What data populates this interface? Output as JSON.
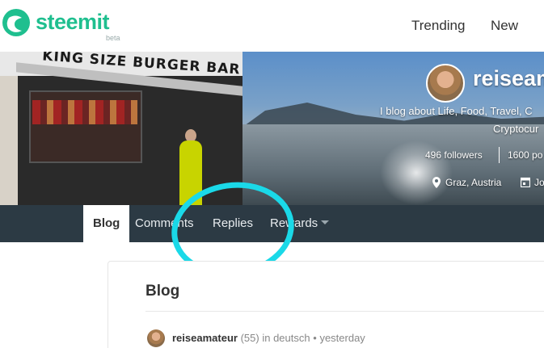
{
  "header": {
    "brand": "steemit",
    "beta": "beta",
    "nav": {
      "trending": "Trending",
      "new": "New"
    }
  },
  "profile": {
    "username": "reiseam",
    "about_line1": "I blog about Life, Food, Travel, C",
    "about_line2": "Cryptocur",
    "followers": "496 followers",
    "posts": "1600 po",
    "location": "Graz, Austria",
    "joined": "Jo",
    "cover_sign": "KING SIZE BURGER BAR"
  },
  "tabs": {
    "blog": "Blog",
    "comments": "Comments",
    "replies": "Replies",
    "rewards": "Rewards"
  },
  "content": {
    "title": "Blog",
    "post": {
      "author": "reiseamateur",
      "reputation": "(55)",
      "in_label": "in",
      "category": "deutsch",
      "separator": "•",
      "time": "yesterday"
    }
  },
  "colors": {
    "brand": "#1fbf8f",
    "tabbar": "#2c3a44",
    "annotation": "#1ad9e8"
  }
}
